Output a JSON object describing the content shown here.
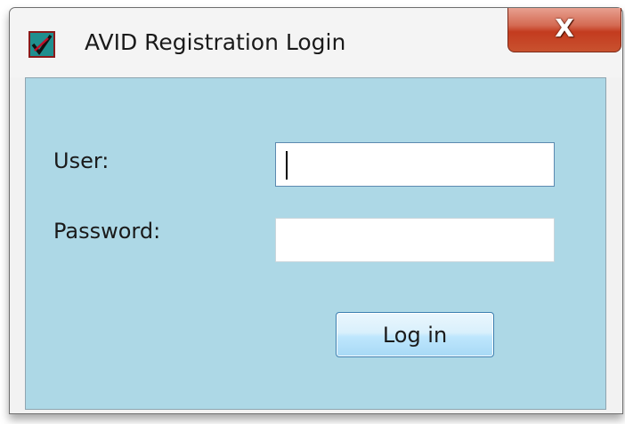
{
  "window": {
    "title": "AVID Registration Login",
    "close_glyph": "X",
    "app_icon": "avid-logo-icon"
  },
  "form": {
    "user_label": "User:",
    "user_value": "",
    "password_label": "Password:",
    "password_value": "",
    "login_label": "Log in"
  },
  "colors": {
    "client_background": "#add8e6",
    "close_button": "#c33b1f",
    "button_border": "#3c7fb1"
  }
}
